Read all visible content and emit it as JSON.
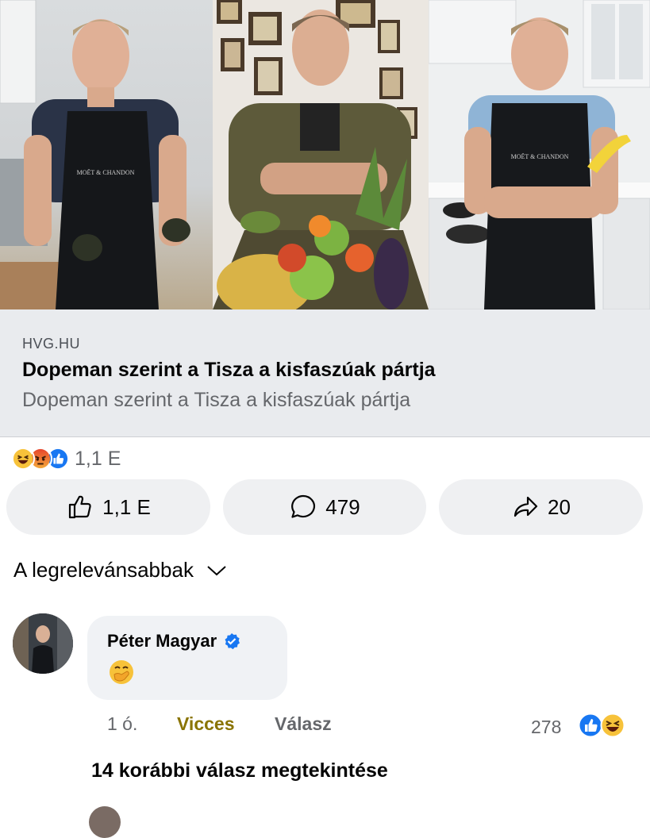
{
  "link": {
    "source": "HVG.HU",
    "title": "Dopeman szerint a Tisza a kisfaszúak pártja",
    "description": "Dopeman szerint a Tisza a kisfaszúak pártja"
  },
  "reactions": {
    "icons": [
      "haha-emoji",
      "angry-emoji",
      "like-icon"
    ],
    "count": "1,1 E"
  },
  "actions": {
    "like_count": "1,1 E",
    "comment_count": "479",
    "share_count": "20"
  },
  "sort": {
    "label": "A legrelevánsabbak"
  },
  "comment": {
    "author": "Péter Magyar",
    "verified": true,
    "emoji": "face-with-hand-over-mouth",
    "time": "1 ó.",
    "reaction_label": "Vicces",
    "reply_label": "Válasz",
    "reaction_count": "278",
    "reaction_icons": [
      "like-icon",
      "haha-emoji"
    ]
  },
  "view_replies": "14 korábbi válasz megtekintése",
  "colors": {
    "accent_blue": "#1877f2",
    "funny_gold": "#8a7400",
    "link_bg": "#e9ebee",
    "button_bg": "#eff0f2"
  }
}
